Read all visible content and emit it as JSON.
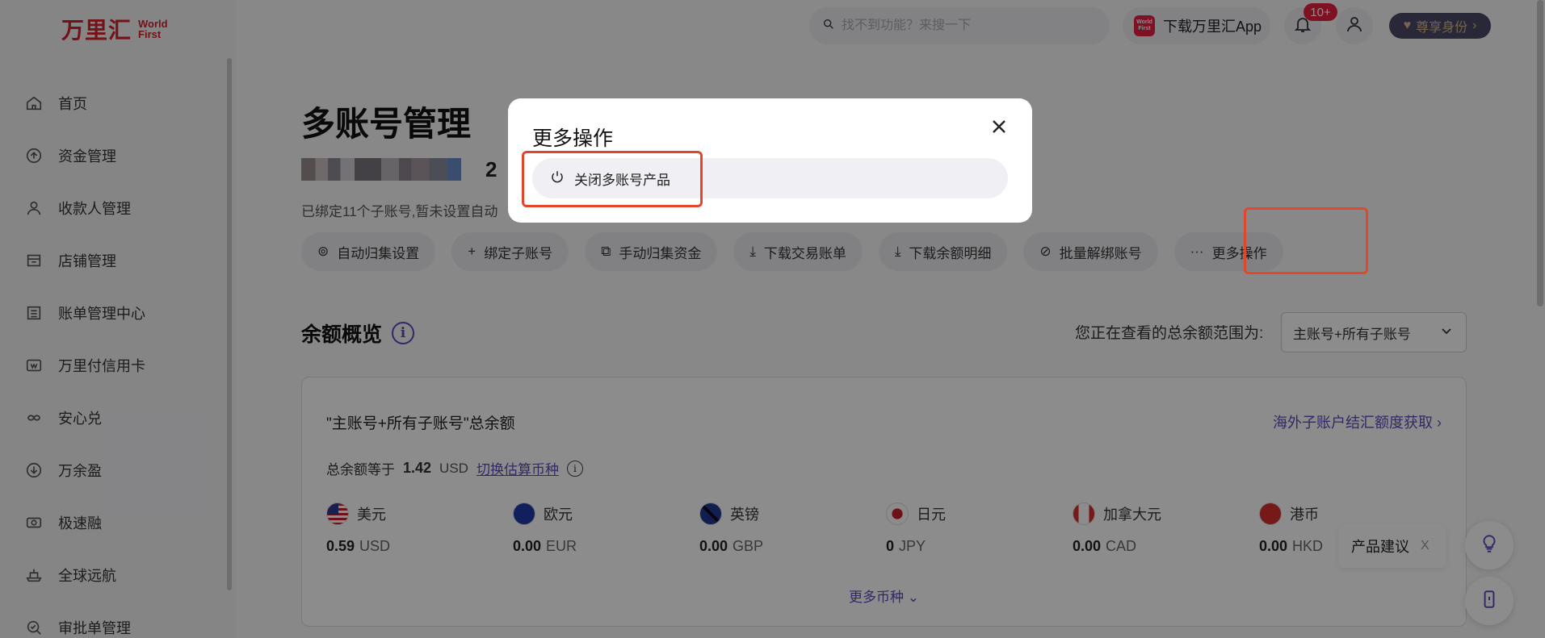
{
  "brand": {
    "name_cn": "万里汇",
    "name_en_1": "World",
    "name_en_2": "First"
  },
  "sidebar": {
    "items": [
      {
        "label": "首页",
        "icon": "home-icon"
      },
      {
        "label": "资金管理",
        "icon": "arrow-up-circle-icon"
      },
      {
        "label": "收款人管理",
        "icon": "user-icon"
      },
      {
        "label": "店铺管理",
        "icon": "store-icon"
      },
      {
        "label": "账单管理中心",
        "icon": "list-icon"
      },
      {
        "label": "万里付信用卡",
        "icon": "card-w-icon"
      },
      {
        "label": "安心兑",
        "icon": "exchange-icon"
      },
      {
        "label": "万余盈",
        "icon": "shield-down-icon"
      },
      {
        "label": "极速融",
        "icon": "finance-icon"
      },
      {
        "label": "全球远航",
        "icon": "ship-icon"
      },
      {
        "label": "审批单管理",
        "icon": "approve-icon"
      }
    ]
  },
  "topbar": {
    "search_placeholder": "找不到功能？来搜一下",
    "download_app": "下载万里汇App",
    "app_icon_text": "World First",
    "notification_badge": "10+",
    "vip_label": "尊享身份",
    "vip_chevron": "›"
  },
  "main": {
    "title": "多账号管理",
    "account_suffix": "2",
    "summary": "已绑定11个子账号,暂未设置自动",
    "actions": [
      {
        "label": "自动归集设置",
        "icon": "⊚"
      },
      {
        "label": "绑定子账号",
        "icon": "+"
      },
      {
        "label": "手动归集资金",
        "icon": "⧉"
      },
      {
        "label": "下载交易账单",
        "icon": "⤓"
      },
      {
        "label": "下载余额明细",
        "icon": "⤓"
      },
      {
        "label": "批量解绑账号",
        "icon": "⊘"
      },
      {
        "label": "更多操作",
        "icon": "···"
      }
    ],
    "balance_title": "余额概览",
    "range_label": "您正在查看的总余额范围为:",
    "range_value": "主账号+所有子账号",
    "card": {
      "title": "\"主账号+所有子账号\"总余额",
      "link": "海外子账户结汇额度获取",
      "total_prefix": "总余额等于",
      "total_amount": "1.42",
      "total_currency": "USD",
      "switch_label": "切换估算币种",
      "currencies": [
        {
          "name": "美元",
          "amount": "0.59",
          "code": "USD",
          "flag": "flag-us"
        },
        {
          "name": "欧元",
          "amount": "0.00",
          "code": "EUR",
          "flag": "flag-eu"
        },
        {
          "name": "英镑",
          "amount": "0.00",
          "code": "GBP",
          "flag": "flag-gb"
        },
        {
          "name": "日元",
          "amount": "0",
          "code": "JPY",
          "flag": "flag-jp"
        },
        {
          "name": "加拿大元",
          "amount": "0.00",
          "code": "CAD",
          "flag": "flag-ca"
        },
        {
          "name": "港币",
          "amount": "0.00",
          "code": "HKD",
          "flag": "flag-hk"
        }
      ],
      "more_currencies": "更多币种"
    }
  },
  "floating": {
    "suggest_label": "产品建议",
    "suggest_close": "X"
  },
  "modal": {
    "title": "更多操作",
    "option": "关闭多账号产品"
  },
  "colors": {
    "brand_red": "#d3212d",
    "accent_purple": "#5a4bbd",
    "highlight": "#e2472c"
  }
}
